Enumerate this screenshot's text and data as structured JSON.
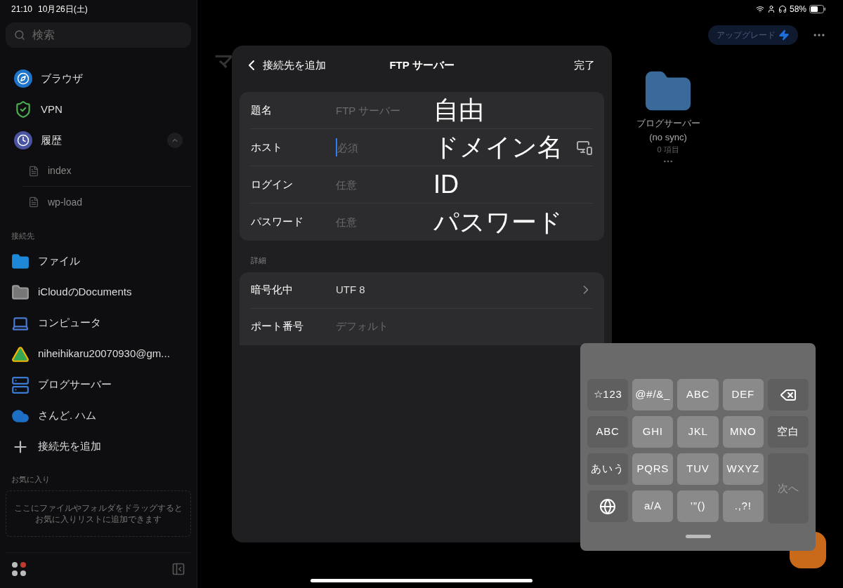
{
  "status_bar": {
    "time": "21:10",
    "date": "10月26日(土)",
    "battery": "58%"
  },
  "sidebar": {
    "search": {
      "placeholder": "検索"
    },
    "items": [
      {
        "label": "ブラウザ"
      },
      {
        "label": "VPN"
      },
      {
        "label": "履歴",
        "expanded": true,
        "children": [
          {
            "label": "index"
          },
          {
            "label": "wp-load"
          }
        ]
      }
    ],
    "connections_heading": "接続先",
    "connections": [
      {
        "label": "ファイル"
      },
      {
        "label": "iCloudのDocuments"
      },
      {
        "label": "コンピュータ"
      },
      {
        "label": "niheihikaru20070930@gm..."
      },
      {
        "label": "ブログサーバー"
      },
      {
        "label": "さんど. ハム"
      },
      {
        "label": "接続先を追加"
      }
    ],
    "favorites_heading": "お気に入り",
    "favorites_hint": [
      "ここにファイルやフォルダをドラッグすると",
      "お気に入りリストに追加できます"
    ]
  },
  "main": {
    "title_partial": "マ",
    "upgrade": "アップグレード",
    "folder": {
      "name": "ブログサーバー",
      "sync": "(no sync)",
      "count": "0 項目"
    }
  },
  "dialog": {
    "back": "接続先を追加",
    "title": "FTP サーバー",
    "done": "完了",
    "fields": [
      {
        "label": "題名",
        "placeholder": "FTP サーバー",
        "annotation": "自由",
        "focused": false
      },
      {
        "label": "ホスト",
        "placeholder": "必須",
        "annotation": "ドメイン名",
        "focused": true
      },
      {
        "label": "ログイン",
        "placeholder": "任意",
        "annotation": "ID",
        "focused": false
      },
      {
        "label": "パスワード",
        "placeholder": "任意",
        "annotation": "パスワード",
        "focused": false
      }
    ],
    "details_heading": "詳細",
    "details": [
      {
        "label": "暗号化中",
        "value": "UTF 8",
        "kind": "picker"
      },
      {
        "label": "ポート番号",
        "placeholder": "デフォルト",
        "kind": "input"
      }
    ]
  },
  "keyboard": {
    "rows": [
      [
        {
          "label": "☆123",
          "kind": "func"
        },
        {
          "label": "@#/&_",
          "kind": "key"
        },
        {
          "label": "ABC",
          "kind": "key"
        },
        {
          "label": "DEF",
          "kind": "key"
        },
        {
          "kind": "delete"
        }
      ],
      [
        {
          "label": "ABC",
          "kind": "func"
        },
        {
          "label": "GHI",
          "kind": "key"
        },
        {
          "label": "JKL",
          "kind": "key"
        },
        {
          "label": "MNO",
          "kind": "key"
        },
        {
          "label": "空白",
          "kind": "func"
        }
      ],
      [
        {
          "label": "あいう",
          "kind": "func"
        },
        {
          "label": "PQRS",
          "kind": "key"
        },
        {
          "label": "TUV",
          "kind": "key"
        },
        {
          "label": "WXYZ",
          "kind": "key"
        },
        {
          "label": "次へ",
          "kind": "enter"
        }
      ],
      [
        {
          "kind": "globe"
        },
        {
          "label": "a/A",
          "kind": "key"
        },
        {
          "label": "’”()",
          "kind": "key"
        },
        {
          "label": ".,?!",
          "kind": "key"
        }
      ]
    ]
  }
}
